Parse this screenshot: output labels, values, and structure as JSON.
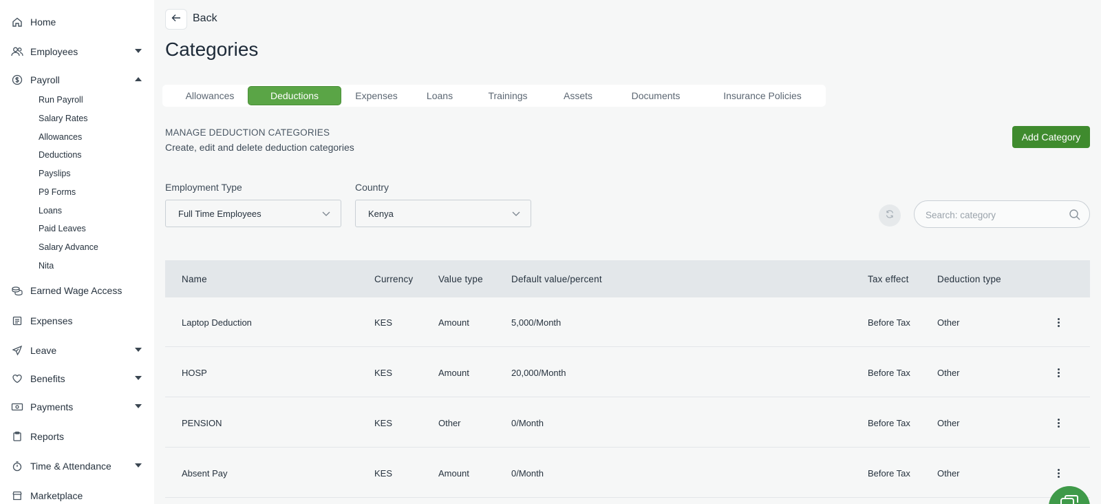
{
  "sidebar": {
    "home": "Home",
    "employees": "Employees",
    "payroll": "Payroll",
    "payroll_sub": [
      "Run Payroll",
      "Salary Rates",
      "Allowances",
      "Deductions",
      "Payslips",
      "P9 Forms",
      "Loans",
      "Paid Leaves",
      "Salary Advance",
      "Nita"
    ],
    "earned_wage_access": "Earned Wage Access",
    "expenses": "Expenses",
    "leave": "Leave",
    "benefits": "Benefits",
    "payments": "Payments",
    "reports": "Reports",
    "time_attendance": "Time & Attendance",
    "marketplace": "Marketplace"
  },
  "header": {
    "back_label": "Back",
    "title": "Categories"
  },
  "tabs": [
    "Allowances",
    "Deductions",
    "Expenses",
    "Loans",
    "Trainings",
    "Assets",
    "Documents",
    "Insurance Policies"
  ],
  "active_tab": "Deductions",
  "section": {
    "title": "MANAGE DEDUCTION CATEGORIES",
    "subtitle": "Create, edit and delete deduction categories",
    "add_button": "Add Category"
  },
  "filters": {
    "employment_type_label": "Employment Type",
    "employment_type_value": "Full Time Employees",
    "country_label": "Country",
    "country_value": "Kenya"
  },
  "search": {
    "placeholder": "Search: category"
  },
  "table": {
    "columns": [
      "Name",
      "Currency",
      "Value type",
      "Default value/percent",
      "Tax effect",
      "Deduction type"
    ],
    "rows": [
      [
        "Laptop Deduction",
        "KES",
        "Amount",
        "5,000/Month",
        "Before Tax",
        "Other"
      ],
      [
        "HOSP",
        "KES",
        "Amount",
        "20,000/Month",
        "Before Tax",
        "Other"
      ],
      [
        "PENSION",
        "KES",
        "Other",
        "0/Month",
        "Before Tax",
        "Other"
      ],
      [
        "Absent Pay",
        "KES",
        "Amount",
        "0/Month",
        "Before Tax",
        "Other"
      ]
    ]
  },
  "colors": {
    "accent": "#5aa546",
    "primary_button": "#3f8b2e",
    "table_header_bg": "#e3e7ea"
  }
}
